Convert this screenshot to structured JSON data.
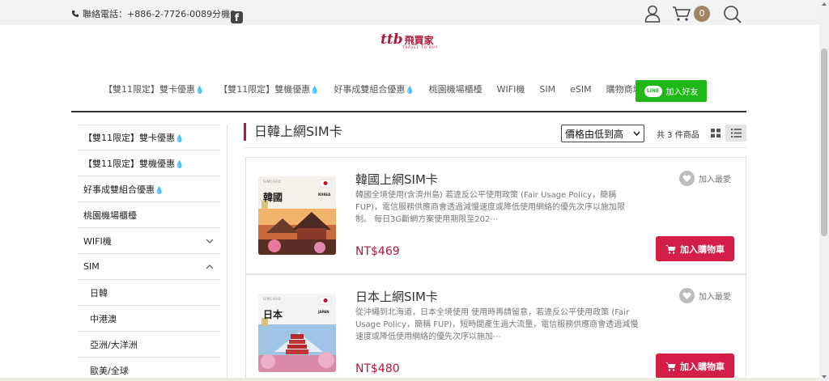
{
  "topbar": {
    "phone_label": "聯絡電話：",
    "phone_number": "+886-2-7726-0089分機9",
    "cart_count": "0"
  },
  "logo": {
    "mark": "ttb",
    "text": "飛買家",
    "sub": "TRAVEL TO BUY"
  },
  "nav": {
    "items": [
      "【雙11限定】雙卡優惠",
      "【雙11限定】雙機優惠",
      "好事成雙組合優惠",
      "桃園機場櫃檯",
      "WIFI機",
      "SIM",
      "eSIM",
      "購物商城"
    ],
    "line_badge": "LINE",
    "line_label": "加入好友"
  },
  "sidebar": {
    "items": [
      "【雙11限定】雙卡優惠",
      "【雙11限定】雙機優惠",
      "好事成雙組合優惠",
      "桃園機場櫃檯",
      "WIFI機",
      "SIM"
    ],
    "subitems": [
      "日韓",
      "中港澳",
      "亞洲/大洋洲",
      "歐美/全球"
    ]
  },
  "content": {
    "title": "日韓上網SIM卡",
    "sort_label": "價格由低到高",
    "count_label": "共 3 件商品"
  },
  "products": [
    {
      "title": "韓國上網SIM卡",
      "description": "韓國全境使用(含濟州島) 若違反公平使用政策 (Fair Usage Policy，簡稱 FUP)，電信服務供應商會透過減慢速度或降低使用網絡的優先次序以施加限制。 每日3G斷網方案使用期限至202⋯",
      "price": "NT$469",
      "favorite_label": "加入最愛",
      "cart_label": "加入購物車",
      "image_tag": "SIMCARD",
      "image_name": "韓國",
      "image_country": "KOREA"
    },
    {
      "title": "日本上網SIM卡",
      "description": "從沖繩到北海道，日本全境使用 使用時再請留意，若違反公平使用政策 (Fair Usage Policy，簡稱 FUP)，短時間產生過大流量，電信服務供應商會透過減慢速度或降低使用網絡的優先次序以施加⋯",
      "price": "NT$480",
      "favorite_label": "加入最愛",
      "cart_label": "加入購物車",
      "image_tag": "SIMCARD",
      "image_name": "日本",
      "image_country": "JAPAN"
    }
  ],
  "colors": {
    "brand": "#b3153b",
    "cart_button": "#d31e48",
    "line_green": "#1fb816",
    "accent_drop": "#f0b400"
  },
  "icons": [
    "phone-icon",
    "facebook-icon",
    "user-icon",
    "cart-icon",
    "search-icon",
    "heart-icon",
    "grid-view-icon",
    "list-view-icon",
    "chevron-down-icon",
    "chevron-up-icon",
    "cart-button-icon"
  ]
}
